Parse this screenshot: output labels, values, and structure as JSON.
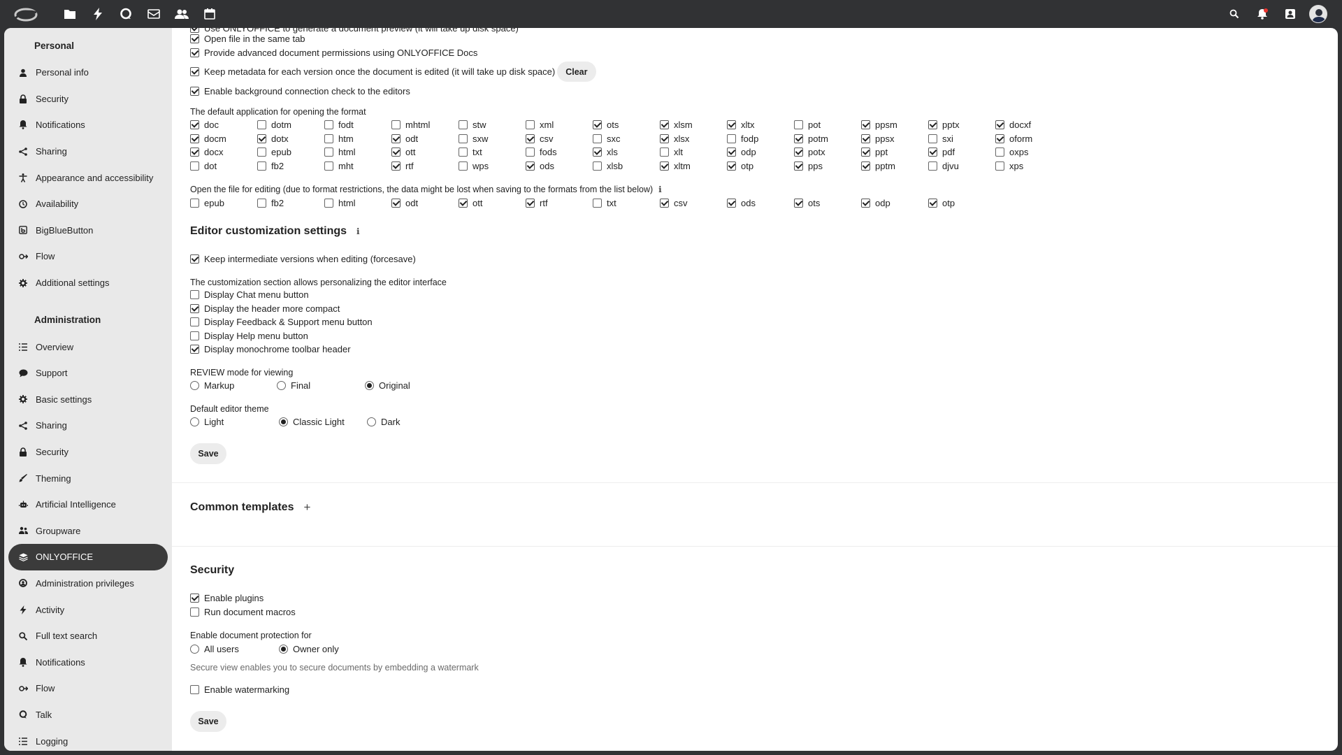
{
  "topbar": {
    "apps": [
      "files-icon",
      "activity-icon",
      "talk-icon",
      "mail-icon",
      "contacts-icon",
      "calendar-icon"
    ],
    "right": [
      "search-icon",
      "notifications-icon",
      "contacts-menu-icon"
    ]
  },
  "sidebar": {
    "personal_caption": "Personal",
    "personal": [
      {
        "label": "Personal info",
        "icon": "user-icon"
      },
      {
        "label": "Security",
        "icon": "lock-icon"
      },
      {
        "label": "Notifications",
        "icon": "bell-icon"
      },
      {
        "label": "Sharing",
        "icon": "share-icon"
      },
      {
        "label": "Appearance and accessibility",
        "icon": "accessibility-icon"
      },
      {
        "label": "Availability",
        "icon": "clock-icon"
      },
      {
        "label": "BigBlueButton",
        "icon": "bbb-icon"
      },
      {
        "label": "Flow",
        "icon": "flow-icon"
      },
      {
        "label": "Additional settings",
        "icon": "gear-icon"
      }
    ],
    "admin_caption": "Administration",
    "admin": [
      {
        "label": "Overview",
        "icon": "list-icon"
      },
      {
        "label": "Support",
        "icon": "support-icon"
      },
      {
        "label": "Basic settings",
        "icon": "gear-icon"
      },
      {
        "label": "Sharing",
        "icon": "share-icon"
      },
      {
        "label": "Security",
        "icon": "lock-icon"
      },
      {
        "label": "Theming",
        "icon": "brush-icon"
      },
      {
        "label": "Artificial Intelligence",
        "icon": "ai-icon"
      },
      {
        "label": "Groupware",
        "icon": "groupware-icon"
      },
      {
        "label": "ONLYOFFICE",
        "icon": "onlyoffice-icon",
        "active": true
      },
      {
        "label": "Administration privileges",
        "icon": "privileges-icon"
      },
      {
        "label": "Activity",
        "icon": "activity-icon"
      },
      {
        "label": "Full text search",
        "icon": "search-icon"
      },
      {
        "label": "Notifications",
        "icon": "bell-icon"
      },
      {
        "label": "Flow",
        "icon": "flow-icon"
      },
      {
        "label": "Talk",
        "icon": "talk-icon"
      },
      {
        "label": "Logging",
        "icon": "list-icon"
      }
    ]
  },
  "general": {
    "cut_text": "Use ONLYOFFICE to generate a document preview (it will take up disk space)",
    "options": [
      {
        "label": "Open file in the same tab",
        "checked": true
      },
      {
        "label": "Provide advanced document permissions using ONLYOFFICE Docs",
        "checked": true
      }
    ],
    "keep_metadata": {
      "label": "Keep metadata for each version once the document is edited (it will take up disk space)",
      "checked": true
    },
    "clear_label": "Clear",
    "bg_check": {
      "label": "Enable background connection check to the editors",
      "checked": true
    }
  },
  "default_app": {
    "label": "The default application for opening the format",
    "formats": [
      [
        "doc",
        1
      ],
      [
        "dotm",
        0
      ],
      [
        "fodt",
        0
      ],
      [
        "mhtml",
        0
      ],
      [
        "stw",
        0
      ],
      [
        "xml",
        0
      ],
      [
        "ots",
        1
      ],
      [
        "xlsm",
        1
      ],
      [
        "xltx",
        1
      ],
      [
        "pot",
        0
      ],
      [
        "ppsm",
        1
      ],
      [
        "pptx",
        1
      ],
      [
        "docxf",
        1
      ],
      [
        "docm",
        1
      ],
      [
        "dotx",
        1
      ],
      [
        "htm",
        0
      ],
      [
        "odt",
        1
      ],
      [
        "sxw",
        0
      ],
      [
        "csv",
        1
      ],
      [
        "sxc",
        0
      ],
      [
        "xlsx",
        1
      ],
      [
        "fodp",
        0
      ],
      [
        "potm",
        1
      ],
      [
        "ppsx",
        1
      ],
      [
        "sxi",
        0
      ],
      [
        "oform",
        1
      ],
      [
        "docx",
        1
      ],
      [
        "epub",
        0
      ],
      [
        "html",
        0
      ],
      [
        "ott",
        1
      ],
      [
        "txt",
        0
      ],
      [
        "fods",
        0
      ],
      [
        "xls",
        1
      ],
      [
        "xlt",
        0
      ],
      [
        "odp",
        1
      ],
      [
        "potx",
        1
      ],
      [
        "ppt",
        1
      ],
      [
        "pdf",
        1
      ],
      [
        "oxps",
        0
      ],
      [
        "dot",
        0
      ],
      [
        "fb2",
        0
      ],
      [
        "mht",
        0
      ],
      [
        "rtf",
        1
      ],
      [
        "wps",
        0
      ],
      [
        "ods",
        1
      ],
      [
        "xlsb",
        0
      ],
      [
        "xltm",
        1
      ],
      [
        "otp",
        1
      ],
      [
        "pps",
        1
      ],
      [
        "pptm",
        1
      ],
      [
        "djvu",
        0
      ],
      [
        "xps",
        0
      ]
    ]
  },
  "edit_formats": {
    "label": "Open the file for editing (due to format restrictions, the data might be lost when saving to the formats from the list below)",
    "formats": [
      [
        "epub",
        0
      ],
      [
        "fb2",
        0
      ],
      [
        "html",
        0
      ],
      [
        "odt",
        1
      ],
      [
        "ott",
        1
      ],
      [
        "rtf",
        1
      ],
      [
        "txt",
        0
      ],
      [
        "csv",
        1
      ],
      [
        "ods",
        1
      ],
      [
        "ots",
        1
      ],
      [
        "odp",
        1
      ],
      [
        "otp",
        1
      ]
    ]
  },
  "editor": {
    "title": "Editor customization settings",
    "forcesave": {
      "label": "Keep intermediate versions when editing (forcesave)",
      "checked": true
    },
    "custom_label": "The customization section allows personalizing the editor interface",
    "custom": [
      {
        "label": "Display Chat menu button",
        "checked": false
      },
      {
        "label": "Display the header more compact",
        "checked": true
      },
      {
        "label": "Display Feedback & Support menu button",
        "checked": false
      },
      {
        "label": "Display Help menu button",
        "checked": false
      },
      {
        "label": "Display monochrome toolbar header",
        "checked": true
      }
    ],
    "review_label": "REVIEW mode for viewing",
    "review": [
      {
        "label": "Markup",
        "checked": false
      },
      {
        "label": "Final",
        "checked": false
      },
      {
        "label": "Original",
        "checked": true
      }
    ],
    "theme_label": "Default editor theme",
    "theme": [
      {
        "label": "Light",
        "checked": false
      },
      {
        "label": "Classic Light",
        "checked": true
      },
      {
        "label": "Dark",
        "checked": false
      }
    ],
    "save_label": "Save"
  },
  "templates": {
    "title": "Common templates",
    "add": "+"
  },
  "security": {
    "title": "Security",
    "options": [
      {
        "label": "Enable plugins",
        "checked": true
      },
      {
        "label": "Run document macros",
        "checked": false
      }
    ],
    "protection_label": "Enable document protection for",
    "protection": [
      {
        "label": "All users",
        "checked": false
      },
      {
        "label": "Owner only",
        "checked": true
      }
    ],
    "secure_hint": "Secure view enables you to secure documents by embedding a watermark",
    "watermark": {
      "label": "Enable watermarking",
      "checked": false
    },
    "save_label": "Save"
  }
}
